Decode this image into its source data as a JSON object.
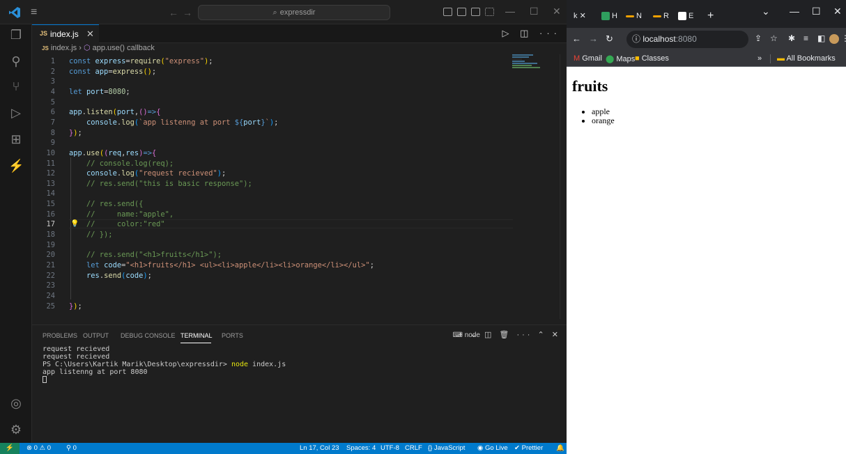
{
  "vscode": {
    "search_text": "expressdir",
    "tab_label": "index.js",
    "tab_icon": "JS",
    "breadcrumb": {
      "file": "index.js",
      "symbol": "app.use() callback"
    },
    "panel_tabs": [
      "PROBLEMS",
      "OUTPUT",
      "DEBUG CONSOLE",
      "TERMINAL",
      "PORTS"
    ],
    "terminal_shell": "node",
    "terminal_lines": [
      "request recieved",
      "request recieved",
      "PS C:\\Users\\Kartik Marik\\Desktop\\expressdir> ",
      "app listenng at port 8080"
    ],
    "terminal_command": "node index.js",
    "status": {
      "errors": "0",
      "warnings": "0",
      "ports": "0",
      "position": "Ln 17, Col 23",
      "spaces": "Spaces: 4",
      "encoding": "UTF-8",
      "eol": "CRLF",
      "language": "JavaScript",
      "golive": "Go Live",
      "prettier": "Prettier"
    },
    "current_line": 17
  },
  "browser": {
    "tabs": [
      "k",
      "H",
      "N",
      "R",
      "E"
    ],
    "url_host": "localhost",
    "url_port": ":8080",
    "bookmarks": [
      "Gmail",
      "Maps",
      "Classes"
    ],
    "all_bookmarks": "All Bookmarks",
    "page_heading": "fruits",
    "page_items": [
      "apple",
      "orange"
    ]
  },
  "colors": {
    "accent": "#007acc",
    "remote": "#16825d",
    "keyword": "#569cd6",
    "string": "#ce9178",
    "comment": "#6a9955",
    "function": "#dcdcaa"
  }
}
